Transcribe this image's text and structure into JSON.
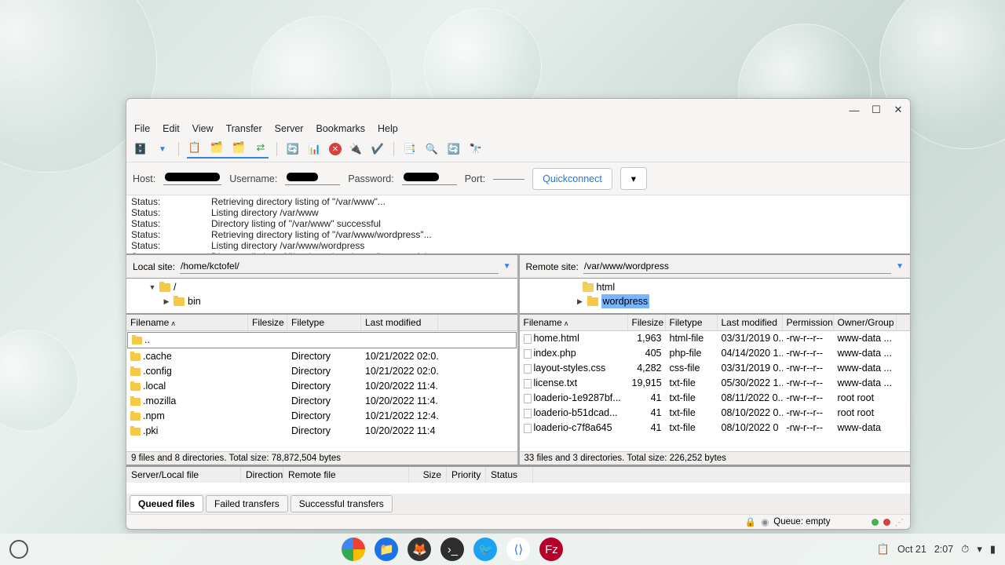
{
  "menubar": [
    "File",
    "Edit",
    "View",
    "Transfer",
    "Server",
    "Bookmarks",
    "Help"
  ],
  "connect": {
    "host_lbl": "Host:",
    "user_lbl": "Username:",
    "pass_lbl": "Password:",
    "port_lbl": "Port:",
    "quick": "Quickconnect"
  },
  "log": [
    {
      "s": "Status:",
      "m": "Retrieving directory listing of \"/var/www\"..."
    },
    {
      "s": "Status:",
      "m": "Listing directory /var/www"
    },
    {
      "s": "Status:",
      "m": "Directory listing of \"/var/www\" successful"
    },
    {
      "s": "Status:",
      "m": "Retrieving directory listing of \"/var/www/wordpress\"..."
    },
    {
      "s": "Status:",
      "m": "Listing directory /var/www/wordpress"
    },
    {
      "s": "Status:",
      "m": "Directory listing of \"/var/www/wordpress\" successful"
    }
  ],
  "local": {
    "label": "Local site:",
    "path": "/home/kctofel/",
    "tree_root": "/",
    "tree_child": "bin",
    "headers": {
      "name": "Filename",
      "size": "Filesize",
      "type": "Filetype",
      "mod": "Last modified"
    },
    "rows": [
      {
        "name": "..",
        "size": "",
        "type": "",
        "mod": "",
        "icon": "folder",
        "sel": true
      },
      {
        "name": ".cache",
        "size": "",
        "type": "Directory",
        "mod": "10/21/2022 02:0...",
        "icon": "folder"
      },
      {
        "name": ".config",
        "size": "",
        "type": "Directory",
        "mod": "10/21/2022 02:0...",
        "icon": "folder"
      },
      {
        "name": ".local",
        "size": "",
        "type": "Directory",
        "mod": "10/20/2022 11:4...",
        "icon": "folder"
      },
      {
        "name": ".mozilla",
        "size": "",
        "type": "Directory",
        "mod": "10/20/2022 11:4...",
        "icon": "folder"
      },
      {
        "name": ".npm",
        "size": "",
        "type": "Directory",
        "mod": "10/21/2022 12:4...",
        "icon": "folder"
      },
      {
        "name": ".pki",
        "size": "",
        "type": "Directory",
        "mod": "10/20/2022 11:4",
        "icon": "folder"
      }
    ],
    "status": "9 files and 8 directories. Total size: 78,872,504 bytes"
  },
  "remote": {
    "label": "Remote site:",
    "path": "/var/www/wordpress",
    "tree_node1": "html",
    "tree_node2": "wordpress",
    "headers": {
      "name": "Filename",
      "size": "Filesize",
      "type": "Filetype",
      "mod": "Last modified",
      "perm": "Permissions",
      "own": "Owner/Group"
    },
    "rows": [
      {
        "name": "home.html",
        "size": "1,963",
        "type": "html-file",
        "mod": "03/31/2019 0...",
        "perm": "-rw-r--r--",
        "own": "www-data ...",
        "icon": "file"
      },
      {
        "name": "index.php",
        "size": "405",
        "type": "php-file",
        "mod": "04/14/2020 1...",
        "perm": "-rw-r--r--",
        "own": "www-data ...",
        "icon": "file"
      },
      {
        "name": "layout-styles.css",
        "size": "4,282",
        "type": "css-file",
        "mod": "03/31/2019 0...",
        "perm": "-rw-r--r--",
        "own": "www-data ...",
        "icon": "file"
      },
      {
        "name": "license.txt",
        "size": "19,915",
        "type": "txt-file",
        "mod": "05/30/2022 1...",
        "perm": "-rw-r--r--",
        "own": "www-data ...",
        "icon": "file"
      },
      {
        "name": "loaderio-1e9287bf...",
        "size": "41",
        "type": "txt-file",
        "mod": "08/11/2022 0...",
        "perm": "-rw-r--r--",
        "own": "root root",
        "icon": "file"
      },
      {
        "name": "loaderio-b51dcad...",
        "size": "41",
        "type": "txt-file",
        "mod": "08/10/2022 0...",
        "perm": "-rw-r--r--",
        "own": "root root",
        "icon": "file"
      },
      {
        "name": "loaderio-c7f8a645",
        "size": "41",
        "type": "txt-file",
        "mod": "08/10/2022 0",
        "perm": "-rw-r--r--",
        "own": "www-data",
        "icon": "file"
      }
    ],
    "status": "33 files and 3 directories. Total size: 226,252 bytes"
  },
  "queue": {
    "headers": [
      "Server/Local file",
      "Direction",
      "Remote file",
      "Size",
      "Priority",
      "Status"
    ],
    "tabs": [
      "Queued files",
      "Failed transfers",
      "Successful transfers"
    ],
    "status": "Queue: empty"
  },
  "taskbar": {
    "date": "Oct 21",
    "time": "2:07"
  }
}
